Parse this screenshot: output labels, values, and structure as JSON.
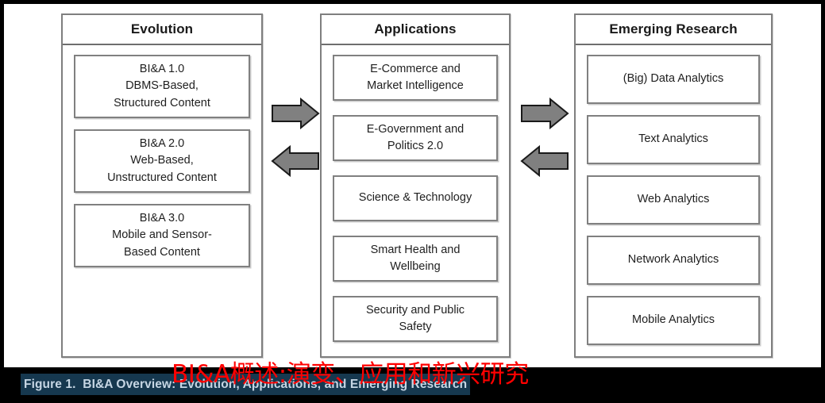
{
  "figure": {
    "caption": "Figure 1.  BI&A Overview: Evolution, Applications, and Emerging Research",
    "translation_overlay": "BI&A概述:演变、应用和新兴研究",
    "caption_highlight_color": "#16384f",
    "caption_text_color": "#c6d6e4",
    "overlay_color": "#ff0000",
    "canvas_background": "#ffffff",
    "page_background": "#000000"
  },
  "columns": [
    {
      "id": "evolution",
      "header": "Evolution",
      "items": [
        {
          "lines": [
            "BI&A 1.0",
            "DBMS-Based,",
            "Structured Content"
          ]
        },
        {
          "lines": [
            "BI&A 2.0",
            "Web-Based,",
            "Unstructured Content"
          ]
        },
        {
          "lines": [
            "BI&A 3.0",
            "Mobile and Sensor-",
            "Based Content"
          ]
        }
      ]
    },
    {
      "id": "applications",
      "header": "Applications",
      "items": [
        {
          "lines": [
            "E-Commerce and",
            "Market Intelligence"
          ]
        },
        {
          "lines": [
            "E-Government and",
            "Politics 2.0"
          ]
        },
        {
          "lines": [
            "Science & Technology"
          ]
        },
        {
          "lines": [
            "Smart Health and",
            "Wellbeing"
          ]
        },
        {
          "lines": [
            "Security and Public",
            "Safety"
          ]
        }
      ]
    },
    {
      "id": "emerging",
      "header": "Emerging Research",
      "items": [
        {
          "lines": [
            "(Big) Data Analytics"
          ]
        },
        {
          "lines": [
            "Text Analytics"
          ]
        },
        {
          "lines": [
            "Web Analytics"
          ]
        },
        {
          "lines": [
            "Network Analytics"
          ]
        },
        {
          "lines": [
            "Mobile Analytics"
          ]
        }
      ]
    }
  ],
  "arrows": {
    "fill_color": "#808080",
    "stroke_color": "#1a1a1a",
    "groups": [
      {
        "id": "evolution-applications",
        "forward": "arrow-right",
        "backward": "arrow-left"
      },
      {
        "id": "applications-emerging",
        "forward": "arrow-right",
        "backward": "arrow-left"
      }
    ]
  }
}
